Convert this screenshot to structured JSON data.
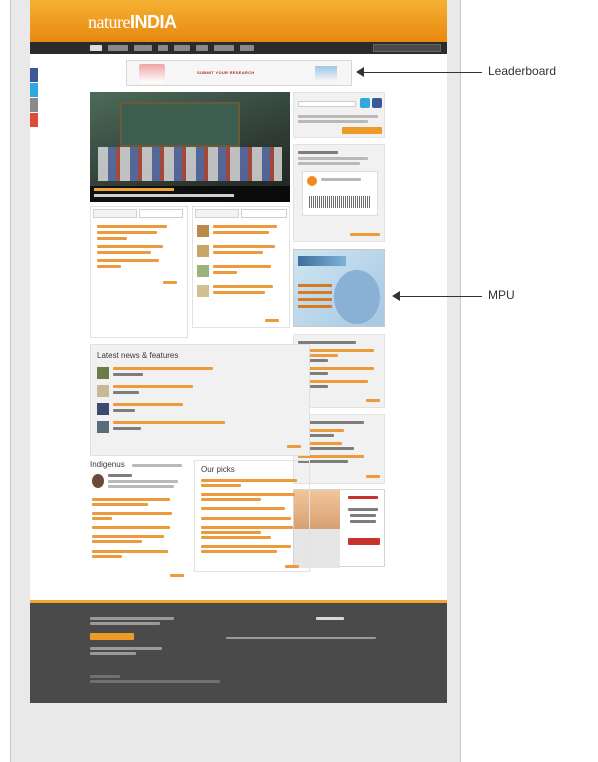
{
  "site": {
    "logo_part1": "nature",
    "logo_part2": "INDIA",
    "leaderboard_text": "SUBMIT YOUR RESEARCH"
  },
  "news": {
    "heading": "Latest news & features"
  },
  "indigenus": {
    "heading": "Indigenus"
  },
  "picks": {
    "heading": "Our picks"
  },
  "callouts": {
    "leaderboard": "Leaderboard",
    "mpu": "MPU"
  },
  "colors": {
    "brand_orange": "#e8870f",
    "nav_dark": "#2b2b2b",
    "footer": "#4a4a4a",
    "link_orange": "#ec9a3c"
  }
}
